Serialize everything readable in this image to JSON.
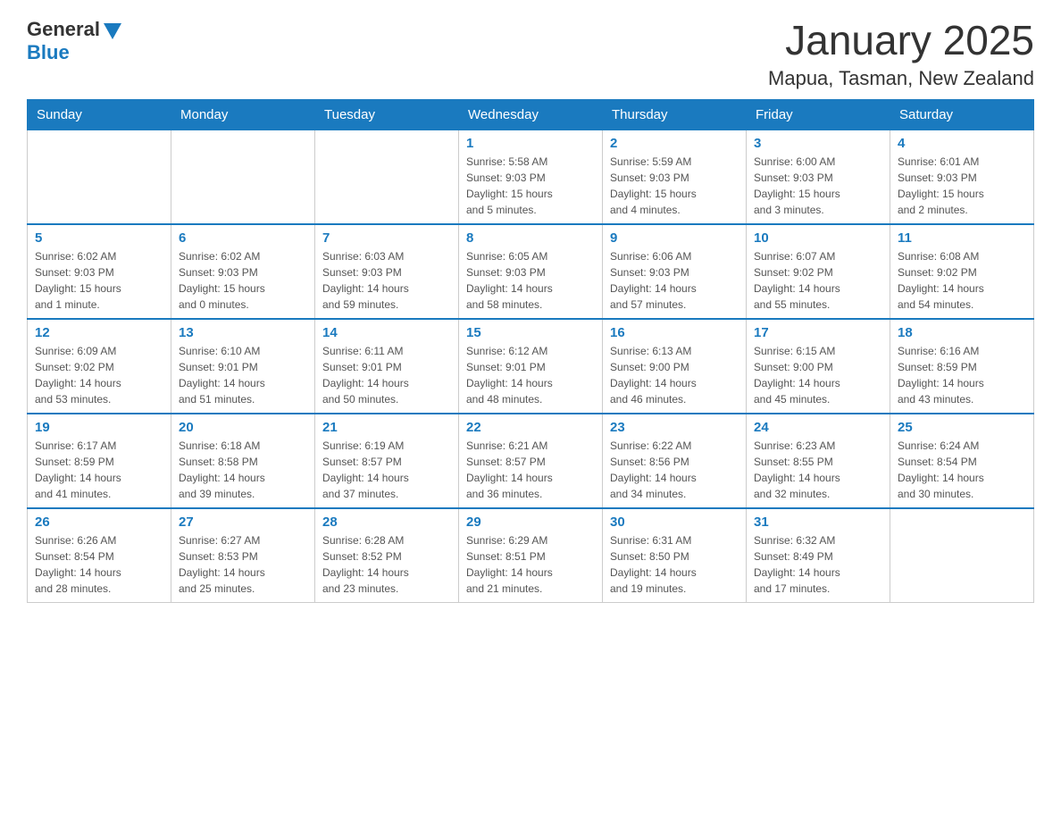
{
  "header": {
    "logo_general": "General",
    "logo_blue": "Blue",
    "title": "January 2025",
    "subtitle": "Mapua, Tasman, New Zealand"
  },
  "days_of_week": [
    "Sunday",
    "Monday",
    "Tuesday",
    "Wednesday",
    "Thursday",
    "Friday",
    "Saturday"
  ],
  "weeks": [
    [
      {
        "day": "",
        "info": ""
      },
      {
        "day": "",
        "info": ""
      },
      {
        "day": "",
        "info": ""
      },
      {
        "day": "1",
        "info": "Sunrise: 5:58 AM\nSunset: 9:03 PM\nDaylight: 15 hours\nand 5 minutes."
      },
      {
        "day": "2",
        "info": "Sunrise: 5:59 AM\nSunset: 9:03 PM\nDaylight: 15 hours\nand 4 minutes."
      },
      {
        "day": "3",
        "info": "Sunrise: 6:00 AM\nSunset: 9:03 PM\nDaylight: 15 hours\nand 3 minutes."
      },
      {
        "day": "4",
        "info": "Sunrise: 6:01 AM\nSunset: 9:03 PM\nDaylight: 15 hours\nand 2 minutes."
      }
    ],
    [
      {
        "day": "5",
        "info": "Sunrise: 6:02 AM\nSunset: 9:03 PM\nDaylight: 15 hours\nand 1 minute."
      },
      {
        "day": "6",
        "info": "Sunrise: 6:02 AM\nSunset: 9:03 PM\nDaylight: 15 hours\nand 0 minutes."
      },
      {
        "day": "7",
        "info": "Sunrise: 6:03 AM\nSunset: 9:03 PM\nDaylight: 14 hours\nand 59 minutes."
      },
      {
        "day": "8",
        "info": "Sunrise: 6:05 AM\nSunset: 9:03 PM\nDaylight: 14 hours\nand 58 minutes."
      },
      {
        "day": "9",
        "info": "Sunrise: 6:06 AM\nSunset: 9:03 PM\nDaylight: 14 hours\nand 57 minutes."
      },
      {
        "day": "10",
        "info": "Sunrise: 6:07 AM\nSunset: 9:02 PM\nDaylight: 14 hours\nand 55 minutes."
      },
      {
        "day": "11",
        "info": "Sunrise: 6:08 AM\nSunset: 9:02 PM\nDaylight: 14 hours\nand 54 minutes."
      }
    ],
    [
      {
        "day": "12",
        "info": "Sunrise: 6:09 AM\nSunset: 9:02 PM\nDaylight: 14 hours\nand 53 minutes."
      },
      {
        "day": "13",
        "info": "Sunrise: 6:10 AM\nSunset: 9:01 PM\nDaylight: 14 hours\nand 51 minutes."
      },
      {
        "day": "14",
        "info": "Sunrise: 6:11 AM\nSunset: 9:01 PM\nDaylight: 14 hours\nand 50 minutes."
      },
      {
        "day": "15",
        "info": "Sunrise: 6:12 AM\nSunset: 9:01 PM\nDaylight: 14 hours\nand 48 minutes."
      },
      {
        "day": "16",
        "info": "Sunrise: 6:13 AM\nSunset: 9:00 PM\nDaylight: 14 hours\nand 46 minutes."
      },
      {
        "day": "17",
        "info": "Sunrise: 6:15 AM\nSunset: 9:00 PM\nDaylight: 14 hours\nand 45 minutes."
      },
      {
        "day": "18",
        "info": "Sunrise: 6:16 AM\nSunset: 8:59 PM\nDaylight: 14 hours\nand 43 minutes."
      }
    ],
    [
      {
        "day": "19",
        "info": "Sunrise: 6:17 AM\nSunset: 8:59 PM\nDaylight: 14 hours\nand 41 minutes."
      },
      {
        "day": "20",
        "info": "Sunrise: 6:18 AM\nSunset: 8:58 PM\nDaylight: 14 hours\nand 39 minutes."
      },
      {
        "day": "21",
        "info": "Sunrise: 6:19 AM\nSunset: 8:57 PM\nDaylight: 14 hours\nand 37 minutes."
      },
      {
        "day": "22",
        "info": "Sunrise: 6:21 AM\nSunset: 8:57 PM\nDaylight: 14 hours\nand 36 minutes."
      },
      {
        "day": "23",
        "info": "Sunrise: 6:22 AM\nSunset: 8:56 PM\nDaylight: 14 hours\nand 34 minutes."
      },
      {
        "day": "24",
        "info": "Sunrise: 6:23 AM\nSunset: 8:55 PM\nDaylight: 14 hours\nand 32 minutes."
      },
      {
        "day": "25",
        "info": "Sunrise: 6:24 AM\nSunset: 8:54 PM\nDaylight: 14 hours\nand 30 minutes."
      }
    ],
    [
      {
        "day": "26",
        "info": "Sunrise: 6:26 AM\nSunset: 8:54 PM\nDaylight: 14 hours\nand 28 minutes."
      },
      {
        "day": "27",
        "info": "Sunrise: 6:27 AM\nSunset: 8:53 PM\nDaylight: 14 hours\nand 25 minutes."
      },
      {
        "day": "28",
        "info": "Sunrise: 6:28 AM\nSunset: 8:52 PM\nDaylight: 14 hours\nand 23 minutes."
      },
      {
        "day": "29",
        "info": "Sunrise: 6:29 AM\nSunset: 8:51 PM\nDaylight: 14 hours\nand 21 minutes."
      },
      {
        "day": "30",
        "info": "Sunrise: 6:31 AM\nSunset: 8:50 PM\nDaylight: 14 hours\nand 19 minutes."
      },
      {
        "day": "31",
        "info": "Sunrise: 6:32 AM\nSunset: 8:49 PM\nDaylight: 14 hours\nand 17 minutes."
      },
      {
        "day": "",
        "info": ""
      }
    ]
  ]
}
